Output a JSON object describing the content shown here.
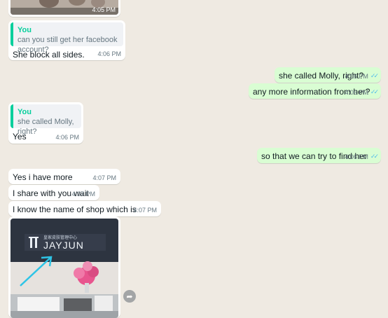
{
  "messages": {
    "m0_time": "4:05 PM",
    "m1": {
      "quote_name": "You",
      "quote_text": "can you still get her facebook account?",
      "text": "She block all sides.",
      "time": "4:06 PM"
    },
    "m2": {
      "text": "she called Molly, right?",
      "time": "4:06 PM"
    },
    "m3": {
      "text": "any more information from her?",
      "time": "4:06 PM"
    },
    "m4": {
      "quote_name": "You",
      "quote_text": "she called Molly, right?",
      "text": "Yes",
      "time": "4:06 PM"
    },
    "m5": {
      "text": "so that we can try to find her",
      "time": "4:06 PM"
    },
    "m6": {
      "text": "Yes i have more information",
      "time": "4:07 PM"
    },
    "m7": {
      "text": "I share with you wait",
      "time": "4:07 PM"
    },
    "m8": {
      "text": "I know the name of shop which is running.",
      "time": "4:07 PM"
    },
    "m9": {
      "sign_text": "JAYJUN",
      "sign_small": "皇家皮肤管理中心"
    }
  },
  "icons": {
    "read_receipt": "double-check-icon",
    "forward": "forward-icon"
  },
  "colors": {
    "background": "#efeae2",
    "incoming": "#ffffff",
    "outgoing": "#d9fdd3",
    "quote_bar": "#06cf9c",
    "read_ticks": "#53bdeb"
  }
}
